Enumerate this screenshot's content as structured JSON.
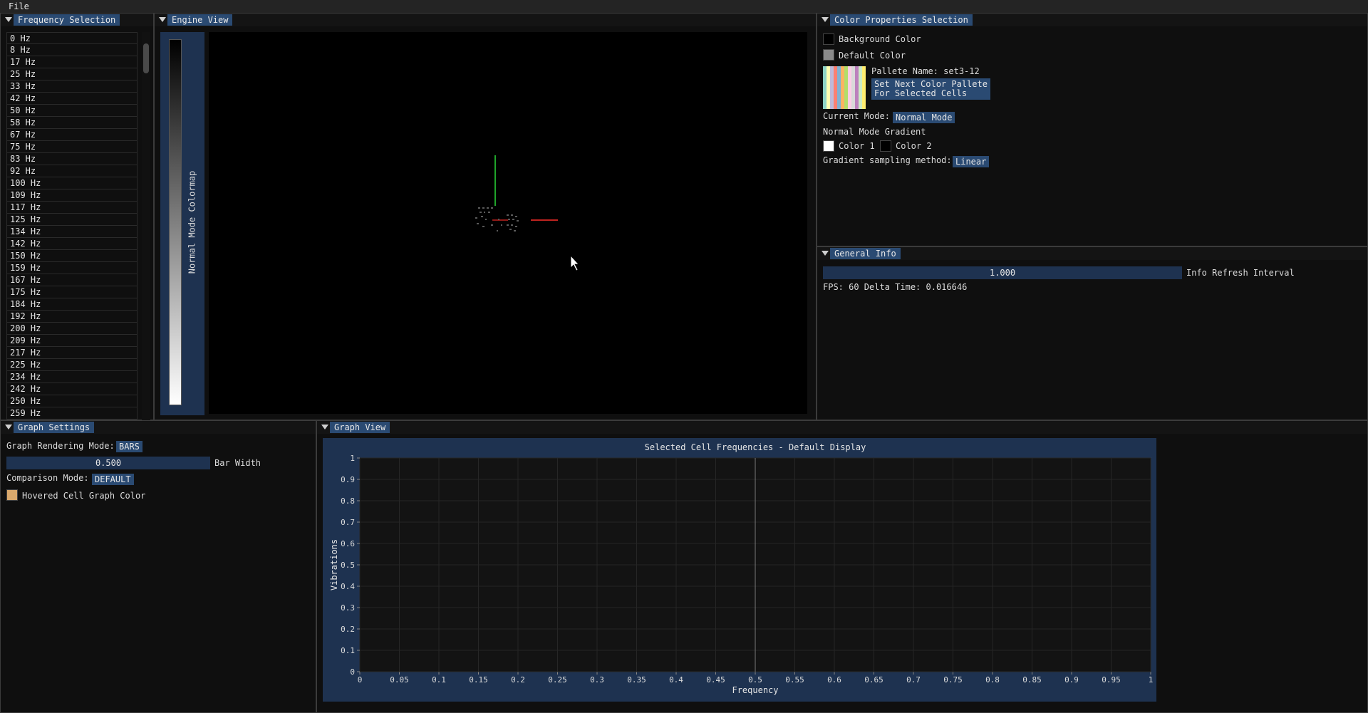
{
  "menu": {
    "file": "File"
  },
  "frequency_panel": {
    "title": "Frequency Selection",
    "items": [
      "0 Hz",
      "8 Hz",
      "17 Hz",
      "25 Hz",
      "33 Hz",
      "42 Hz",
      "50 Hz",
      "58 Hz",
      "67 Hz",
      "75 Hz",
      "83 Hz",
      "92 Hz",
      "100 Hz",
      "109 Hz",
      "117 Hz",
      "125 Hz",
      "134 Hz",
      "142 Hz",
      "150 Hz",
      "159 Hz",
      "167 Hz",
      "175 Hz",
      "184 Hz",
      "192 Hz",
      "200 Hz",
      "209 Hz",
      "217 Hz",
      "225 Hz",
      "234 Hz",
      "242 Hz",
      "250 Hz",
      "259 Hz"
    ]
  },
  "engine_panel": {
    "title": "Engine View",
    "colormap_label": "Normal Mode Colormap"
  },
  "color_panel": {
    "title": "Color Properties Selection",
    "background_color_label": "Background Color",
    "background_color": "#000000",
    "default_color_label": "Default Color",
    "default_color": "#8a8a8a",
    "pallete_name": "Pallete Name: set3-12",
    "pallete_colors": [
      "#8dd3c7",
      "#ffffb3",
      "#bebada",
      "#fb8072",
      "#80b1d3",
      "#fdb462",
      "#b3de69",
      "#fccde5",
      "#d9d9d9",
      "#bc80bd",
      "#ccebc5",
      "#ffed6f"
    ],
    "next_pallete_button": "Set Next Color Pallete\nFor Selected Cells",
    "current_mode_label": "Current Mode:",
    "current_mode_value": "Normal Mode",
    "gradient_heading": "Normal Mode Gradient",
    "color1_label": "Color 1",
    "color1": "#ffffff",
    "color2_label": "Color 2",
    "color2": "#000000",
    "sampling_label": "Gradient sampling method:",
    "sampling_value": "Linear"
  },
  "info_panel": {
    "title": "General Info",
    "refresh_value": "1.000",
    "refresh_label": "Info Refresh Interval",
    "fps_text": "FPS: 60 Delta Time: 0.016646"
  },
  "graph_settings": {
    "title": "Graph Settings",
    "render_mode_label": "Graph Rendering Mode:",
    "render_mode_value": "BARS",
    "bar_width_value": "0.500",
    "bar_width_label": "Bar Width",
    "comparison_label": "Comparison Mode:",
    "comparison_value": "DEFAULT",
    "hover_color_label": "Hovered Cell Graph Color",
    "hover_color": "#d9a86c"
  },
  "graph_view": {
    "title": "Graph View"
  },
  "chart_data": {
    "type": "bar",
    "title": "Selected Cell Frequencies - Default Display",
    "xlabel": "Frequency",
    "ylabel": "Vibrations",
    "xlim": [
      0,
      1
    ],
    "ylim": [
      0,
      1
    ],
    "x_ticks": [
      "0",
      "0.05",
      "0.1",
      "0.15",
      "0.2",
      "0.25",
      "0.3",
      "0.35",
      "0.4",
      "0.45",
      "0.5",
      "0.55",
      "0.6",
      "0.65",
      "0.7",
      "0.75",
      "0.8",
      "0.85",
      "0.9",
      "0.95",
      "1"
    ],
    "y_ticks": [
      "0",
      "0.1",
      "0.2",
      "0.3",
      "0.4",
      "0.5",
      "0.6",
      "0.7",
      "0.8",
      "0.9",
      "1"
    ],
    "grid": true,
    "series": [],
    "marker_line_x": 0.5
  }
}
